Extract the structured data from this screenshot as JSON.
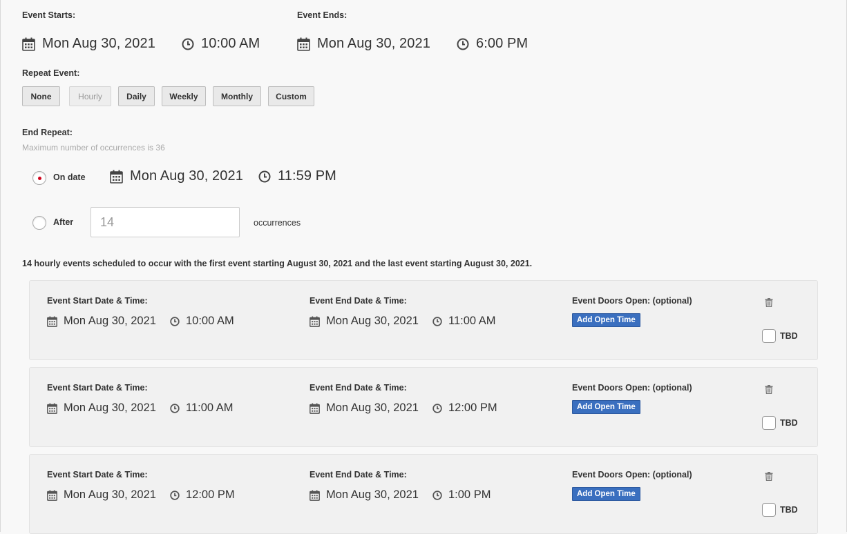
{
  "event_starts": {
    "label": "Event Starts:",
    "date": "Mon Aug 30, 2021",
    "time": "10:00 AM"
  },
  "event_ends": {
    "label": "Event Ends:",
    "date": "Mon Aug 30, 2021",
    "time": "6:00 PM"
  },
  "repeat": {
    "label": "Repeat Event:",
    "options": [
      "None",
      "Hourly",
      "Daily",
      "Weekly",
      "Monthly",
      "Custom"
    ],
    "selected": "Hourly"
  },
  "end_repeat": {
    "label": "End Repeat:",
    "hint": "Maximum number of occurrences is 36",
    "on_date_label": "On date",
    "on_date_checked": true,
    "date": "Mon Aug 30, 2021",
    "time": "11:59 PM",
    "after_label": "After",
    "occurrences_value": "14",
    "occurrences_label": "occurrences"
  },
  "summary": "14 hourly events scheduled to occur with the first event starting August 30, 2021 and the last event starting August 30, 2021.",
  "occurrence_labels": {
    "start": "Event Start Date & Time:",
    "end": "Event End Date & Time:",
    "doors": "Event Doors Open: (optional)",
    "add_open_time": "Add Open Time",
    "tbd": "TBD"
  },
  "occurrences": [
    {
      "start_date": "Mon Aug 30, 2021",
      "start_time": "10:00 AM",
      "end_date": "Mon Aug 30, 2021",
      "end_time": "11:00 AM"
    },
    {
      "start_date": "Mon Aug 30, 2021",
      "start_time": "11:00 AM",
      "end_date": "Mon Aug 30, 2021",
      "end_time": "12:00 PM"
    },
    {
      "start_date": "Mon Aug 30, 2021",
      "start_time": "12:00 PM",
      "end_date": "Mon Aug 30, 2021",
      "end_time": "1:00 PM"
    }
  ],
  "colors": {
    "accent_blue": "#3a6fbf",
    "radio_dot": "#d0021b",
    "card_bg": "#f1f1f1"
  }
}
